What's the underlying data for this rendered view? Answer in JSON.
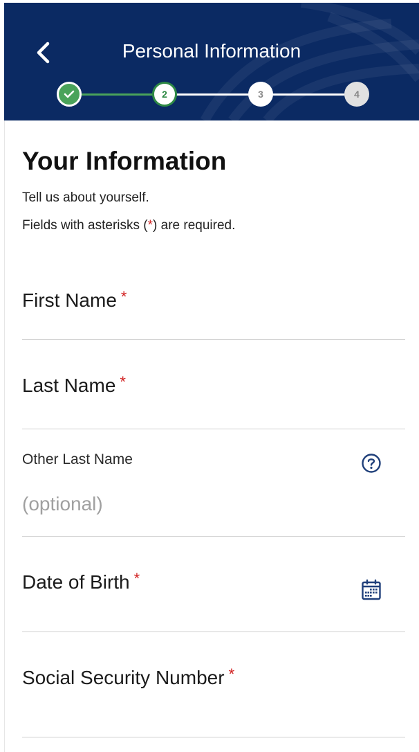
{
  "header": {
    "title": "Personal Information",
    "back_icon": "chevron-left-icon",
    "bg_color": "#0b2a63",
    "steps": [
      {
        "label": "",
        "state": "done",
        "icon": "check-icon"
      },
      {
        "label": "2",
        "state": "current"
      },
      {
        "label": "3",
        "state": "upcoming"
      },
      {
        "label": "4",
        "state": "upcoming-disabled"
      }
    ]
  },
  "intro": {
    "title": "Your Information",
    "line1": "Tell us about yourself.",
    "line2_prefix": "Fields with asterisks (",
    "line2_asterisk": "*",
    "line2_suffix": ") are required."
  },
  "fields": {
    "first_name": {
      "label": "First Name",
      "required_mark": "*"
    },
    "last_name": {
      "label": "Last Name",
      "required_mark": "*"
    },
    "other_last_name": {
      "label": "Other Last Name",
      "placeholder": "(optional)",
      "help_icon": "question-circle-icon"
    },
    "date_of_birth": {
      "label": "Date of Birth",
      "required_mark": "*",
      "calendar_icon": "calendar-icon"
    },
    "ssn": {
      "label": "Social Security Number",
      "required_mark": "*"
    }
  },
  "colors": {
    "accent_green": "#4aa35a",
    "required_red": "#d11f1f",
    "icon_blue": "#1f3f7a"
  }
}
